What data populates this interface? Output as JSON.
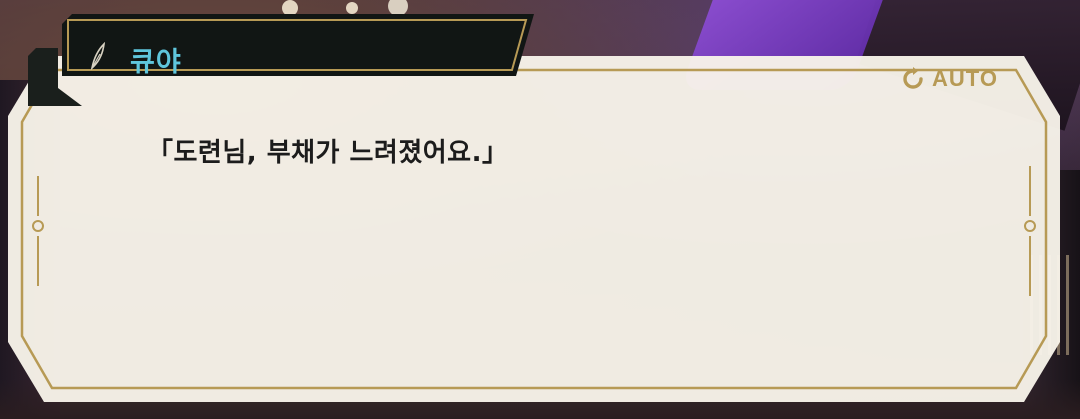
{
  "speaker": {
    "name": "큐야",
    "icon": "quill-icon"
  },
  "dialogue": {
    "text": "「도련님, 부채가 느려졌어요.」"
  },
  "controls": {
    "auto_label": "AUTO",
    "auto_icon": "refresh-icon"
  },
  "colors": {
    "name_text": "#5fc6dc",
    "accent_gold": "#b79a55",
    "panel_bg": "#f8f4ea",
    "nameplate_bg": "#111614"
  }
}
